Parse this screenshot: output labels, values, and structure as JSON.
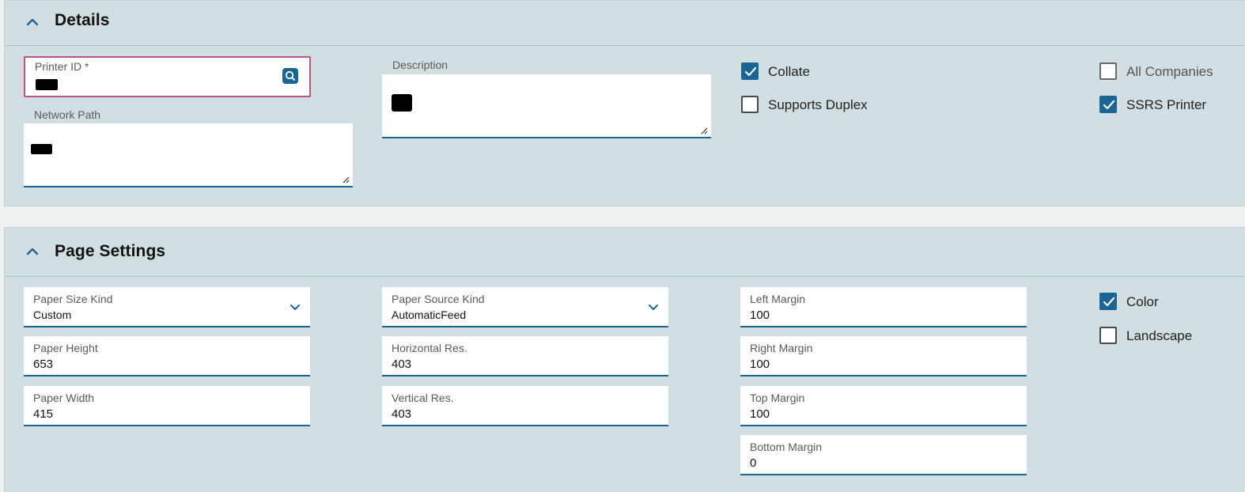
{
  "details": {
    "title": "Details",
    "printer_id": {
      "label": "Printer ID *",
      "value": ""
    },
    "description": {
      "label": "Description",
      "value": ""
    },
    "network_path": {
      "label": "Network Path",
      "value": ""
    },
    "collate": {
      "label": "Collate",
      "checked": true
    },
    "supports_duplex": {
      "label": "Supports Duplex",
      "checked": false
    },
    "all_companies": {
      "label": "All Companies",
      "checked": false
    },
    "ssrs_printer": {
      "label": "SSRS Printer",
      "checked": true
    }
  },
  "page_settings": {
    "title": "Page Settings",
    "paper_size_kind": {
      "label": "Paper Size Kind",
      "value": "Custom"
    },
    "paper_height": {
      "label": "Paper Height",
      "value": "653"
    },
    "paper_width": {
      "label": "Paper Width",
      "value": "415"
    },
    "paper_source_kind": {
      "label": "Paper Source Kind",
      "value": "AutomaticFeed"
    },
    "horizontal_res": {
      "label": "Horizontal Res.",
      "value": "403"
    },
    "vertical_res": {
      "label": "Vertical Res.",
      "value": "403"
    },
    "left_margin": {
      "label": "Left Margin",
      "value": "100"
    },
    "right_margin": {
      "label": "Right Margin",
      "value": "100"
    },
    "top_margin": {
      "label": "Top Margin",
      "value": "100"
    },
    "bottom_margin": {
      "label": "Bottom Margin",
      "value": "0"
    },
    "color": {
      "label": "Color",
      "checked": true
    },
    "landscape": {
      "label": "Landscape",
      "checked": false
    }
  },
  "colors": {
    "accent": "#1a6496",
    "panel_bg": "#d1dfe2",
    "focus_border": "#c0508c"
  },
  "icons": {
    "collapse": "chevron-up-icon",
    "lookup": "search-lookup-icon",
    "dropdown": "chevron-down-icon",
    "check": "checkmark-icon",
    "resize": "resize-grip-icon"
  }
}
